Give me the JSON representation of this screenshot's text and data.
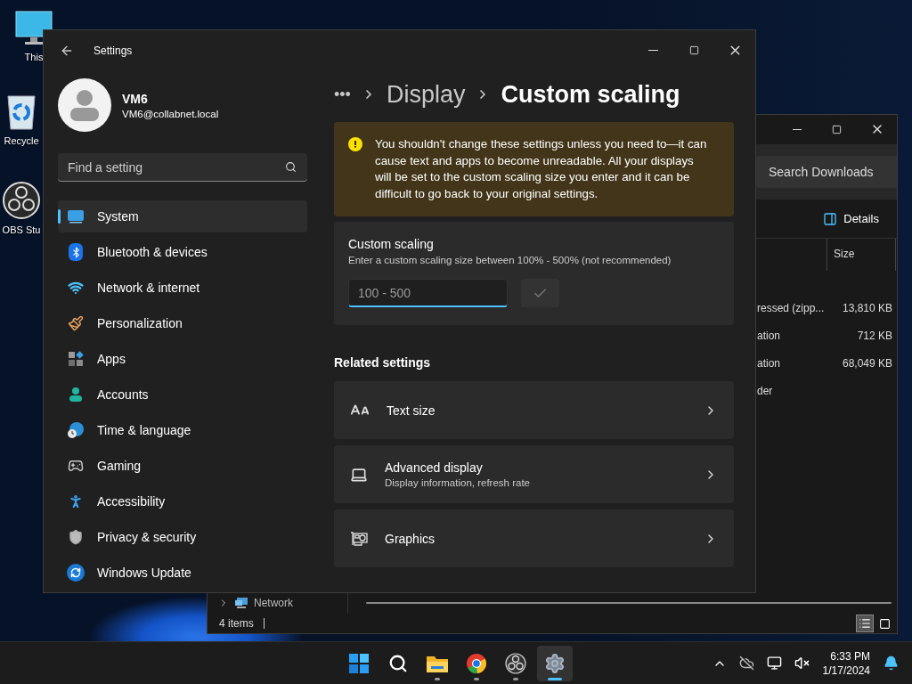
{
  "desktop_icons": [
    {
      "label": "This"
    },
    {
      "label": "Recycle"
    },
    {
      "label": "OBS Stu"
    }
  ],
  "explorer": {
    "search": {
      "placeholder": "Search Downloads"
    },
    "details_button": "Details",
    "columns": [
      "Size"
    ],
    "rows": [
      {
        "column_1": "ressed (zipp...",
        "size": "13,810 KB"
      },
      {
        "column_1": "ation",
        "size": "712 KB"
      },
      {
        "column_1": "ation",
        "size": "68,049 KB"
      },
      {
        "column_1": "der"
      }
    ],
    "nav_item": "Network",
    "status": "4 items"
  },
  "settings": {
    "title": "Settings",
    "user": {
      "name": "VM6",
      "email": "VM6@collabnet.local"
    },
    "search": {
      "placeholder": "Find a setting"
    },
    "sidebar": {
      "items": [
        {
          "label": "System",
          "selected": true
        },
        {
          "label": "Bluetooth & devices",
          "selected": false
        },
        {
          "label": "Network & internet",
          "selected": false
        },
        {
          "label": "Personalization",
          "selected": false
        },
        {
          "label": "Apps",
          "selected": false
        },
        {
          "label": "Accounts",
          "selected": false
        },
        {
          "label": "Time & language",
          "selected": false
        },
        {
          "label": "Gaming",
          "selected": false
        },
        {
          "label": "Accessibility",
          "selected": false
        },
        {
          "label": "Privacy & security",
          "selected": false
        },
        {
          "label": "Windows Update",
          "selected": false
        }
      ]
    },
    "breadcrumb": [
      "•••",
      "Display",
      "Custom scaling"
    ],
    "warning": "You shouldn't change these settings unless you need to—it can cause text and apps to become unreadable. All your displays will be set to the custom scaling size you enter and it can be difficult to go back to your original settings.",
    "custom_scaling": {
      "title": "Custom scaling",
      "description": "Enter a custom scaling size between 100% - 500% (not recommended)",
      "input": {
        "placeholder": "100 - 500",
        "focused": true
      },
      "apply_disabled": true
    },
    "related": {
      "heading": "Related settings",
      "items": [
        {
          "title": "Text size"
        },
        {
          "title": "Advanced display",
          "subtitle": "Display information, refresh rate"
        },
        {
          "title": "Graphics"
        }
      ]
    }
  },
  "taskbar": {
    "apps": [
      {
        "selected": false,
        "running": false
      },
      {
        "selected": false,
        "running": false
      },
      {
        "selected": false,
        "running": true
      },
      {
        "selected": false,
        "running": true
      },
      {
        "selected": false,
        "running": true
      },
      {
        "selected": true,
        "running": true
      }
    ],
    "clock": {
      "time": "6:33 PM",
      "date": "1/17/2024"
    }
  }
}
